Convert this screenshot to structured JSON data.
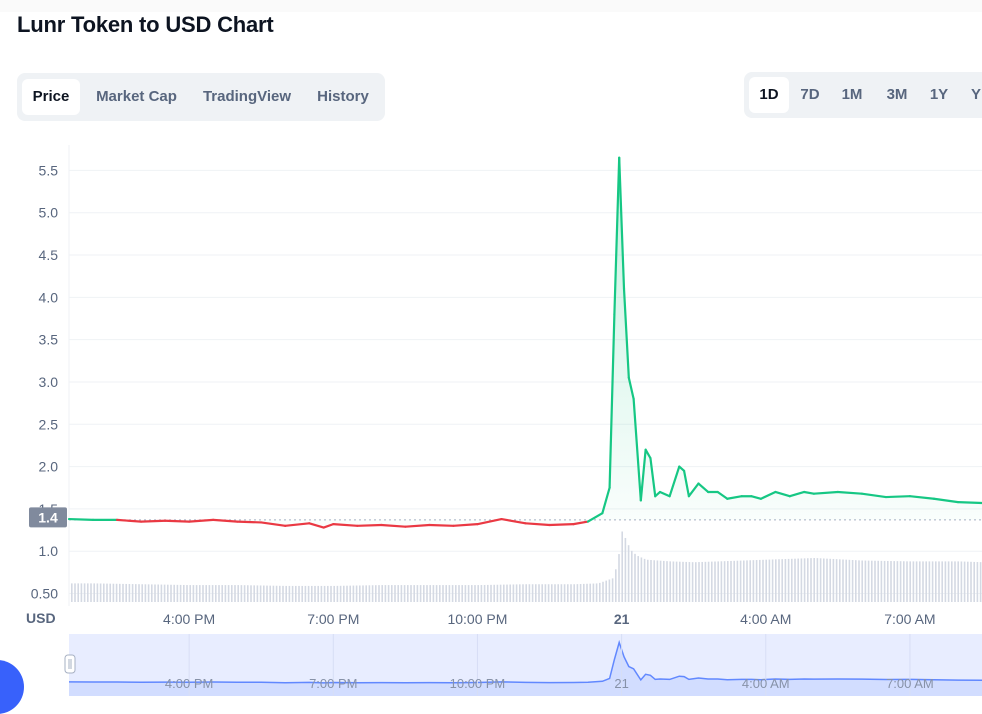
{
  "page": {
    "title": "Lunr Token to USD Chart"
  },
  "tabs": [
    {
      "label": "Price",
      "active": true
    },
    {
      "label": "Market Cap",
      "active": false
    },
    {
      "label": "TradingView",
      "active": false
    },
    {
      "label": "History",
      "active": false
    }
  ],
  "ranges": [
    {
      "label": "1D",
      "active": true
    },
    {
      "label": "7D",
      "active": false
    },
    {
      "label": "1M",
      "active": false
    },
    {
      "label": "3M",
      "active": false
    },
    {
      "label": "1Y",
      "active": false
    },
    {
      "label": "Y",
      "active": false
    }
  ],
  "colors": {
    "up": "#16c784",
    "down": "#ea3943",
    "navigator": "#6188ff",
    "grid": "#eff2f5",
    "axis_text": "#58667e",
    "current_badge": "#808a9d"
  },
  "chart_data": {
    "type": "line",
    "ylabel": "USD",
    "ylim": [
      0.4,
      5.8
    ],
    "yticks": [
      "5.5",
      "5.0",
      "4.5",
      "4.0",
      "3.5",
      "3.0",
      "2.5",
      "2.0",
      "1.5",
      "1.0",
      "0.50"
    ],
    "ytick_values": [
      5.5,
      5.0,
      4.5,
      4.0,
      3.5,
      3.0,
      2.5,
      2.0,
      1.5,
      1.0,
      0.5
    ],
    "current_price_label": "1.4",
    "current_price": 1.4,
    "reference_price": 1.37,
    "xlim": [
      13.5,
      32.5
    ],
    "xticks": [
      {
        "label": "4:00 PM",
        "value": 16
      },
      {
        "label": "7:00 PM",
        "value": 19
      },
      {
        "label": "10:00 PM",
        "value": 22
      },
      {
        "label": "21",
        "value": 25
      },
      {
        "label": "4:00 AM",
        "value": 28
      },
      {
        "label": "7:00 AM",
        "value": 31
      }
    ],
    "series": [
      {
        "x": [
          13.5,
          14.0,
          14.5,
          15.0,
          15.5,
          16.0,
          16.5,
          17.0,
          17.5,
          18.0,
          18.5,
          18.8,
          19.0,
          19.5,
          20.0,
          20.5,
          21.0,
          21.5,
          22.0,
          22.5,
          23.0,
          23.5,
          24.0,
          24.3,
          24.6,
          24.75,
          24.85,
          24.95,
          25.05,
          25.15,
          25.25,
          25.4,
          25.5,
          25.6,
          25.7,
          25.8,
          26.0,
          26.2,
          26.3,
          26.4,
          26.6,
          26.8,
          27.0,
          27.2,
          27.5,
          27.7,
          27.9,
          28.2,
          28.5,
          28.8,
          29.0,
          29.5,
          30.0,
          30.5,
          31.0,
          31.5,
          32.0,
          32.5
        ],
        "y": [
          1.38,
          1.37,
          1.37,
          1.35,
          1.36,
          1.35,
          1.37,
          1.35,
          1.34,
          1.3,
          1.33,
          1.28,
          1.32,
          1.3,
          1.31,
          1.29,
          1.31,
          1.3,
          1.32,
          1.38,
          1.33,
          1.31,
          1.32,
          1.35,
          1.45,
          1.75,
          3.8,
          5.65,
          4.1,
          3.05,
          2.8,
          1.6,
          2.2,
          2.1,
          1.65,
          1.7,
          1.65,
          2.0,
          1.95,
          1.65,
          1.8,
          1.7,
          1.7,
          1.62,
          1.65,
          1.65,
          1.62,
          1.7,
          1.65,
          1.7,
          1.68,
          1.7,
          1.68,
          1.64,
          1.65,
          1.62,
          1.58,
          1.57
        ]
      }
    ],
    "volume": {
      "x": [
        13.5,
        14.0,
        15.0,
        16.0,
        17.0,
        18.0,
        19.0,
        20.0,
        21.0,
        22.0,
        23.0,
        24.0,
        24.5,
        24.8,
        24.9,
        25.0,
        25.1,
        25.2,
        25.3,
        25.5,
        26.0,
        26.5,
        27.0,
        28.0,
        29.0,
        30.0,
        31.0,
        32.0,
        32.5
      ],
      "y": [
        0.62,
        0.62,
        0.61,
        0.6,
        0.6,
        0.59,
        0.59,
        0.6,
        0.6,
        0.6,
        0.61,
        0.61,
        0.62,
        0.68,
        0.85,
        1.25,
        1.1,
        1.0,
        0.95,
        0.9,
        0.88,
        0.87,
        0.88,
        0.9,
        0.92,
        0.89,
        0.88,
        0.88,
        0.87
      ]
    }
  }
}
